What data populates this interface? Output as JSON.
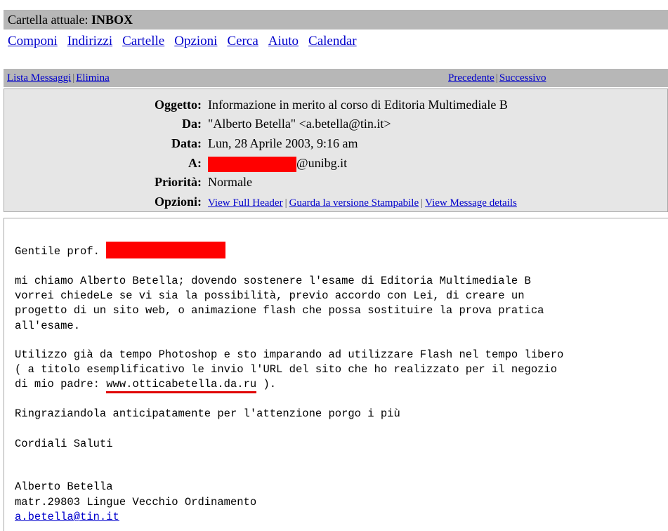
{
  "folder": {
    "prefix": "Cartella attuale:",
    "name": "INBOX"
  },
  "nav": [
    "Componi",
    "Indirizzi",
    "Cartelle",
    "Opzioni",
    "Cerca",
    "Aiuto",
    "Calendar"
  ],
  "message_bar": {
    "list_label": "Lista Messaggi",
    "delete_label": "Elimina",
    "prev_label": "Precedente",
    "next_label": "Successivo",
    "separator": "|"
  },
  "header": {
    "subject_label": "Oggetto:",
    "subject": "Informazione in merito al corso di Editoria Multimediale B",
    "from_label": "Da:",
    "from": "\"Alberto Betella\" <a.betella@tin.it>",
    "date_label": "Data:",
    "date": "Lun, 28 Aprile 2003, 9:16 am",
    "to_label": "A:",
    "to_suffix": "@unibg.it",
    "priority_label": "Priorità:",
    "priority": "Normale",
    "options_label": "Opzioni:",
    "options": [
      "View Full Header",
      "Guarda la versione Stampabile",
      "View Message details"
    ],
    "separator": "|"
  },
  "body": {
    "greeting": "Gentile prof.",
    "p1": [
      "mi chiamo Alberto Betella; dovendo sostenere l'esame di Editoria Multimediale B",
      "vorrei chiedeLe se vi sia la possibilità, previo accordo con Lei, di creare un",
      "progetto di un sito web, o animazione flash che possa sostituire la prova pratica",
      "all'esame."
    ],
    "p2": [
      "Utilizzo già da tempo Photoshop e sto imparando ad utilizzare Flash nel tempo libero",
      "( a titolo esemplificativo le invio l'URL del sito che ho realizzato per il negozio"
    ],
    "p2_last_prefix": "di mio padre: ",
    "p2_link": "www.otticabetella.da.ru",
    "p2_last_suffix": " ).",
    "thanks": "Ringraziandola anticipatamente per l'attenzione porgo i più",
    "closing": "Cordiali Saluti",
    "signature_name": "Alberto Betella",
    "signature_matr": "matr.29803 Lingue Vecchio Ordinamento",
    "signature_email": "a.betella@tin.it"
  },
  "colors": {
    "bar": "#b7b7b7",
    "header_bg": "#e6e6e6",
    "link": "#0000cc",
    "redaction": "#ff0000"
  }
}
